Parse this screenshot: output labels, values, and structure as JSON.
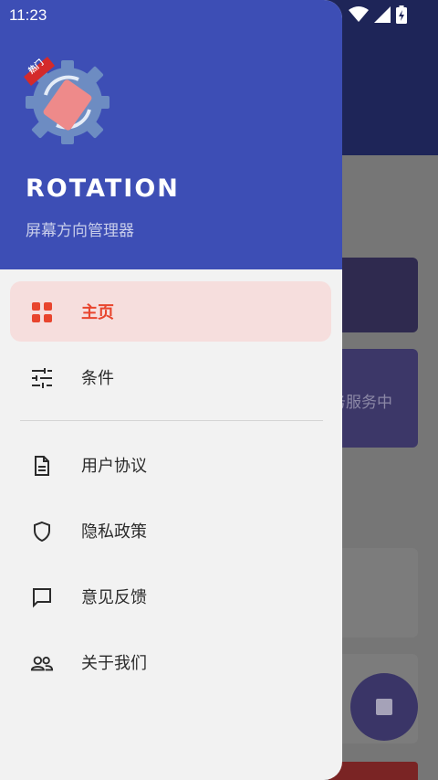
{
  "status_bar": {
    "time": "11:23",
    "icons": [
      "wifi-icon",
      "signal-icon",
      "battery-charging-icon"
    ]
  },
  "drawer": {
    "logo_badge": "热门",
    "app_name": "ROTATION",
    "app_subtitle": "屏幕方向管理器",
    "menu_items": [
      {
        "label": "主页",
        "icon": "grid-icon",
        "active": true
      },
      {
        "label": "条件",
        "icon": "sliders-icon",
        "active": false
      },
      {
        "label": "用户协议",
        "icon": "document-icon",
        "active": false
      },
      {
        "label": "隐私政策",
        "icon": "shield-icon",
        "active": false
      },
      {
        "label": "意见反馈",
        "icon": "chat-icon",
        "active": false
      },
      {
        "label": "关于我们",
        "icon": "people-icon",
        "active": false
      }
    ]
  },
  "background": {
    "card_text": "务服务中"
  },
  "colors": {
    "header": "#3d4eb5",
    "accent": "#e8452e",
    "active_bg": "#f6dedd"
  }
}
